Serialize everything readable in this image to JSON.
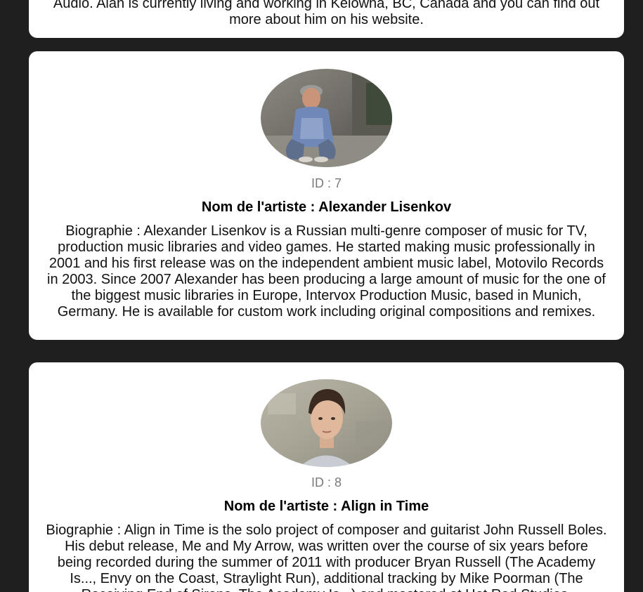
{
  "previous_card": {
    "bio_tail_line1": "Audio. Alan is currently living and working in Kelowna, BC, Canada and you can find out",
    "bio_tail_line2": "more about him on his website."
  },
  "artists": [
    {
      "id_text": "ID : 7",
      "name_text": "Nom de l'artiste : Alexander Lisenkov",
      "bio_text": "Biographie : Alexander Lisenkov is a Russian multi-genre composer of music for TV, production music libraries and video games. He started making music professionally in 2001 and his first release was on the independent ambient music label, Motovilo Records in 2003. Since 2007 Alexander has been producing a large amount of music for the one of the biggest music libraries in Europe, Intervox Production Music, based in Munich, Germany. He is available for custom work including original compositions and remixes."
    },
    {
      "id_text": "ID : 8",
      "name_text": "Nom de l'artiste : Align in Time",
      "bio_text": "Biographie : Align in Time is the solo project of composer and guitarist John Russell Boles. His debut release, Me and My Arrow, was written over the course of six years before being recorded during the summer of 2011 with producer Bryan Russell (The Academy Is..., Envy on the Coast, Straylight Run), additional tracking by Mike Poorman (The Receiving End of Sirens, The Academy Is...) and mastered at Hot Rod Studios."
    }
  ]
}
